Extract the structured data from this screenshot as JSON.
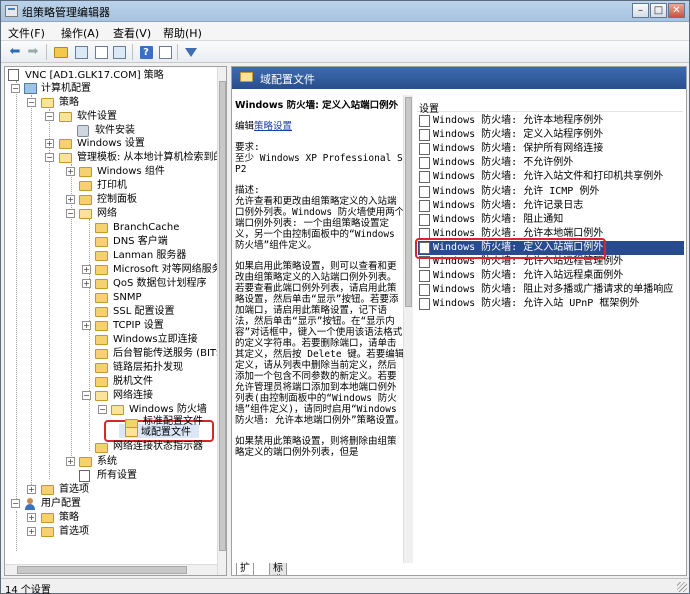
{
  "window": {
    "title": "组策略管理编辑器",
    "controls": {
      "minimize": "–",
      "maximize": "□",
      "close": "✕"
    }
  },
  "menu": [
    "文件(F)",
    "操作(A)",
    "查看(V)",
    "帮助(H)"
  ],
  "toolbar": {
    "icons": [
      "back-arrow-icon",
      "forward-arrow-icon",
      "up-folder-icon",
      "show-hide-tree-icon",
      "export-list-icon",
      "properties-icon",
      "help-icon",
      "console-icon",
      "filter-icon"
    ],
    "glyphs": {
      "back": "⬅",
      "forward": "➡",
      "help": "?"
    }
  },
  "tree": {
    "root": "VNC [AD1.GLK17.COM] 策略",
    "computer_config": "计算机配置",
    "policies": "策略",
    "software_settings": "软件设置",
    "software_install": "软件安装",
    "windows_settings": "Windows 设置",
    "admin_templates": "管理模板: 从本地计算机检索到的",
    "windows_components": "Windows 组件",
    "printers": "打印机",
    "control_panel": "控制面板",
    "network": "网络",
    "branchcache": "BranchCache",
    "dns_client": "DNS 客户端",
    "lanman_server": "Lanman 服务器",
    "ms_p2p": "Microsoft 对等网络服务",
    "qos": "QoS 数据包计划程序",
    "snmp": "SNMP",
    "ssl": "SSL 配置设置",
    "tcpip": "TCPIP 设置",
    "windows_connect_now": "Windows立即连接",
    "bits": "后台智能传送服务 (BITS)",
    "lltd": "链路层拓扑发现",
    "offline_files": "脱机文件",
    "network_connections": "网络连接",
    "windows_firewall": "Windows 防火墙",
    "standard_profile": "标准配置文件",
    "domain_profile": "域配置文件",
    "ncsi": "网络连接状态指示器",
    "system": "系统",
    "all_settings": "所有设置",
    "preferences": "首选项",
    "user_config": "用户配置",
    "user_policies": "策略",
    "user_preferences": "首选项",
    "expand_plus": "+",
    "expand_minus": "−"
  },
  "right": {
    "header": "域配置文件",
    "setting_title": "Windows 防火墙: 定义入站端口例外",
    "edit_prefix": "编辑",
    "edit_link": "策略设置",
    "requirements_label": "要求:",
    "requirements": "至少 Windows XP Professional SP2",
    "description_label": "描述:",
    "description_paragraphs": [
      "允许查看和更改由组策略定义的入站端口例外列表。Windows 防火墙使用两个端口例外列表: 一个由组策略设置定义，另一个由控制面板中的“Windows 防火墙”组件定义。",
      "如果启用此策略设置，则可以查看和更改由组策略定义的入站端口例外列表。若要查看此端口例外列表，请启用此策略设置，然后单击“显示”按钮。若要添加端口，请启用此策略设置，记下语法，然后单击“显示”按钮。在“显示内容”对话框中，键入一个使用该语法格式的定义字符串。若要删除端口，请单击其定义，然后按 Delete 键。若要编辑定义，请从列表中删除当前定义，然后添加一个包含不同参数的新定义。若要允许管理员将端口添加到本地端口例外列表(由控制面板中的“Windows 防火墙”组件定义)，请同时启用“Windows 防火墙: 允许本地端口例外”策略设置。",
      "如果禁用此策略设置，则将删除由组策略定义的端口例外列表，但是"
    ],
    "list_header": "设置",
    "settings": [
      "Windows 防火墙: 允许本地程序例外",
      "Windows 防火墙: 定义入站程序例外",
      "Windows 防火墙: 保护所有网络连接",
      "Windows 防火墙: 不允许例外",
      "Windows 防火墙: 允许入站文件和打印机共享例外",
      "Windows 防火墙: 允许 ICMP 例外",
      "Windows 防火墙: 允许记录日志",
      "Windows 防火墙: 阻止通知",
      "Windows 防火墙: 允许本地端口例外",
      "Windows 防火墙: 定义入站端口例外",
      "Windows 防火墙: 允许入站远程管理例外",
      "Windows 防火墙: 允许入站远程桌面例外",
      "Windows 防火墙: 阻止对多播或广播请求的单播响应",
      "Windows 防火墙: 允许入站 UPnP 框架例外"
    ],
    "selected_index": 9,
    "tabs": [
      "扩展",
      "标准"
    ]
  },
  "status": "14 个设置",
  "colors": {
    "selection": "#284b8f",
    "header": "#3d6bb1",
    "highlight_box": "#d9262a"
  }
}
